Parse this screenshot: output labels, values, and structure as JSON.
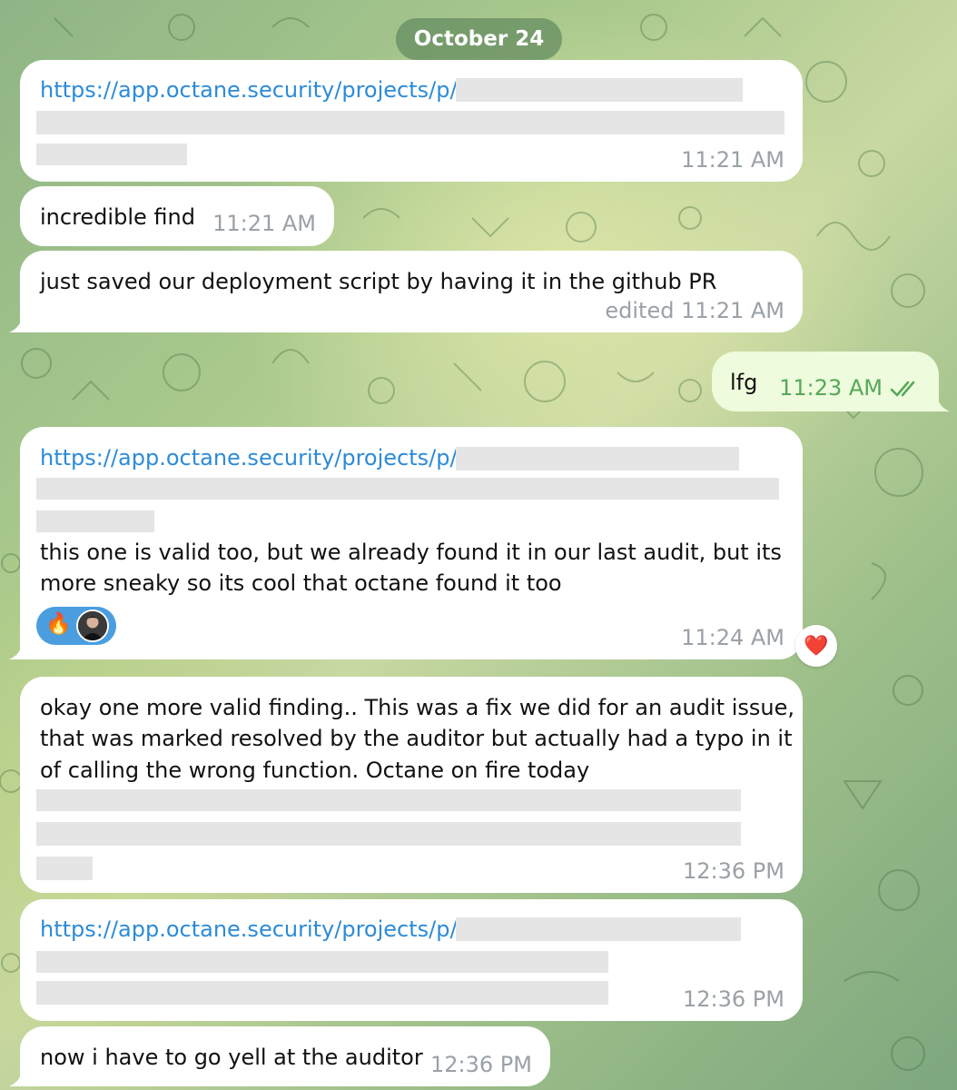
{
  "date_separator": "October 24",
  "messages": [
    {
      "link": "https://app.octane.security/projects/p/",
      "time": "11:21 AM"
    },
    {
      "text": "incredible find",
      "time": "11:21 AM"
    },
    {
      "text": "just saved our deployment script by having it in the github PR",
      "time": "edited 11:21 AM"
    },
    {
      "text": "lfg",
      "time": "11:23 AM",
      "outgoing": true,
      "status_icon": "double-check-icon"
    },
    {
      "link": "https://app.octane.security/projects/p/",
      "text_lines": [
        "this one is valid too, but we already found it in our last audit, but its",
        "more sneaky so its cool that octane found it too"
      ],
      "reactions": {
        "emoji": "🔥",
        "reactor_icon": "user-avatar-icon",
        "side_reaction": "❤️"
      },
      "time": "11:24 AM"
    },
    {
      "text_lines": [
        "okay one more valid finding.. This was a fix we did for an audit issue,",
        "that was marked resolved by the auditor but actually had a typo in it",
        "of calling the wrong function. Octane on fire today"
      ],
      "time": "12:36 PM"
    },
    {
      "link": "https://app.octane.security/projects/p/",
      "time": "12:36 PM"
    },
    {
      "text": "now i have to go yell at the auditor",
      "time": "12:36 PM"
    }
  ],
  "colors": {
    "link": "#2d8bd6",
    "timestamp_in": "#9aa1a6",
    "timestamp_out": "#56a85a",
    "reaction_pill": "#4a9ee0",
    "outgoing_bubble": "#eefbdc"
  }
}
